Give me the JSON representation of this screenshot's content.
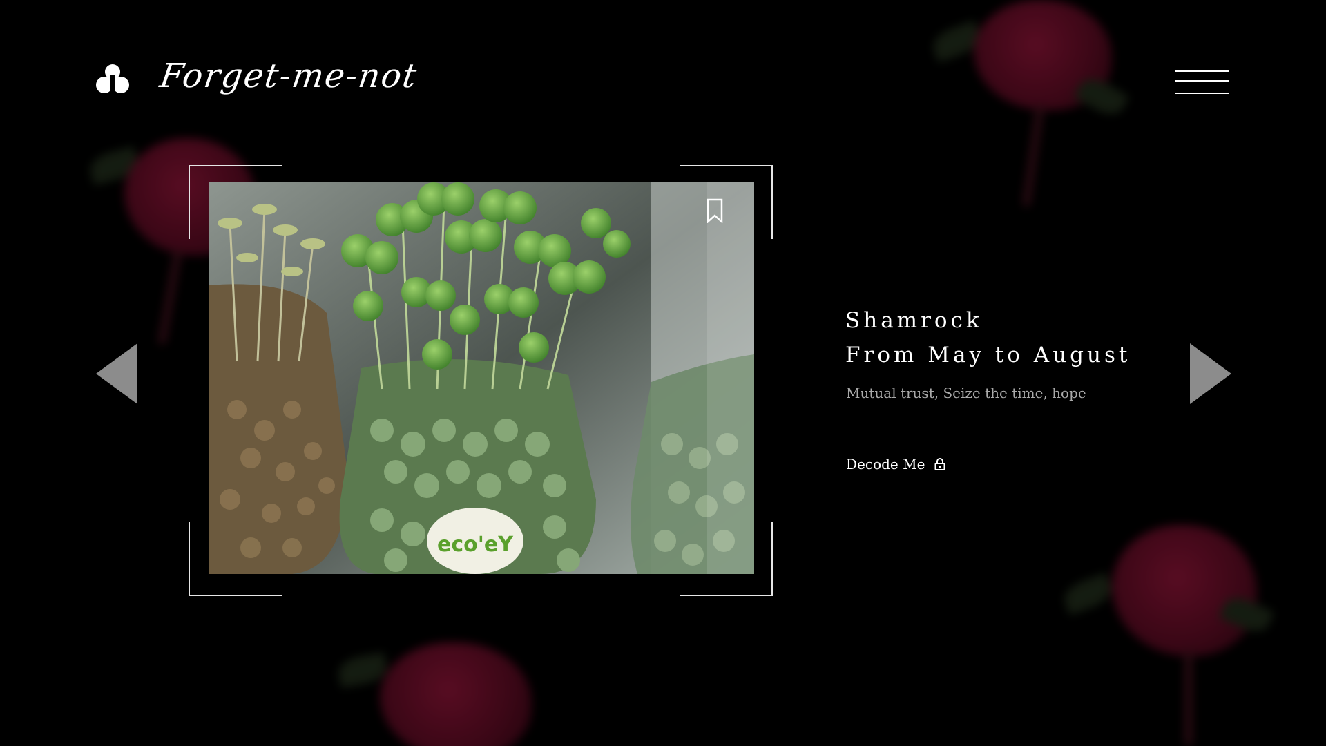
{
  "header": {
    "brand": "Forget-me-not",
    "logo_icon": "club-trefoil-icon",
    "menu_icon": "hamburger-menu-icon"
  },
  "slide": {
    "name": "Shamrock",
    "season": "From May to August",
    "meaning": "Mutual trust, Seize the time, hope",
    "action_label": "Decode Me",
    "action_icon": "lock-icon",
    "photo_label": "eco'eY",
    "bookmark_icon": "bookmark-icon"
  },
  "nav": {
    "prev_icon": "triangle-left-icon",
    "next_icon": "triangle-right-icon"
  },
  "colors": {
    "background": "#000000",
    "text": "#ffffff",
    "muted_text": "#a9a9a9",
    "arrow": "#8c8c8c",
    "rose": "#8a1436"
  }
}
